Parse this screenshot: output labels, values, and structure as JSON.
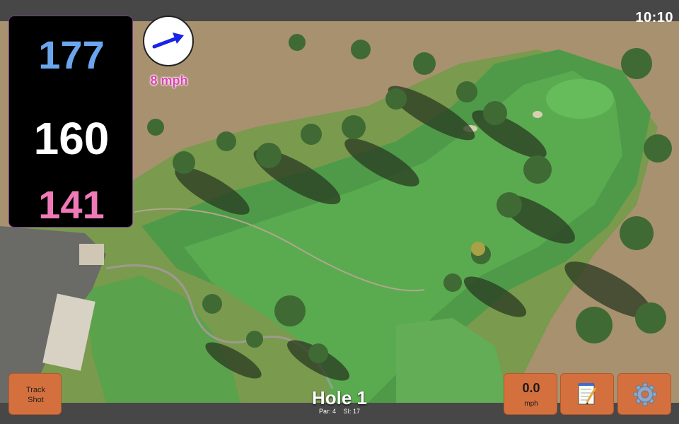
{
  "status_bar": {
    "time": "10:10"
  },
  "distances": {
    "back": "177",
    "middle": "160",
    "front": "141"
  },
  "wind": {
    "speed": "8 mph",
    "direction_icon": "wind-arrow-icon",
    "arrow_color": "#1a24e6"
  },
  "buttons": {
    "track_shot_line1": "Track",
    "track_shot_line2": "Shot",
    "speed_value": "0.0",
    "speed_unit": "mph",
    "notes_icon": "notepad-icon",
    "settings_icon": "gear-icon"
  },
  "hole": {
    "title": "Hole 1",
    "par": "Par: 4",
    "stroke_index": "SI: 17"
  },
  "colors": {
    "back_distance": "#6aa6ee",
    "middle_distance": "#ffffff",
    "front_distance": "#f07ab8",
    "button_fill": "#d4703e",
    "wind_text": "#e13fb8"
  }
}
